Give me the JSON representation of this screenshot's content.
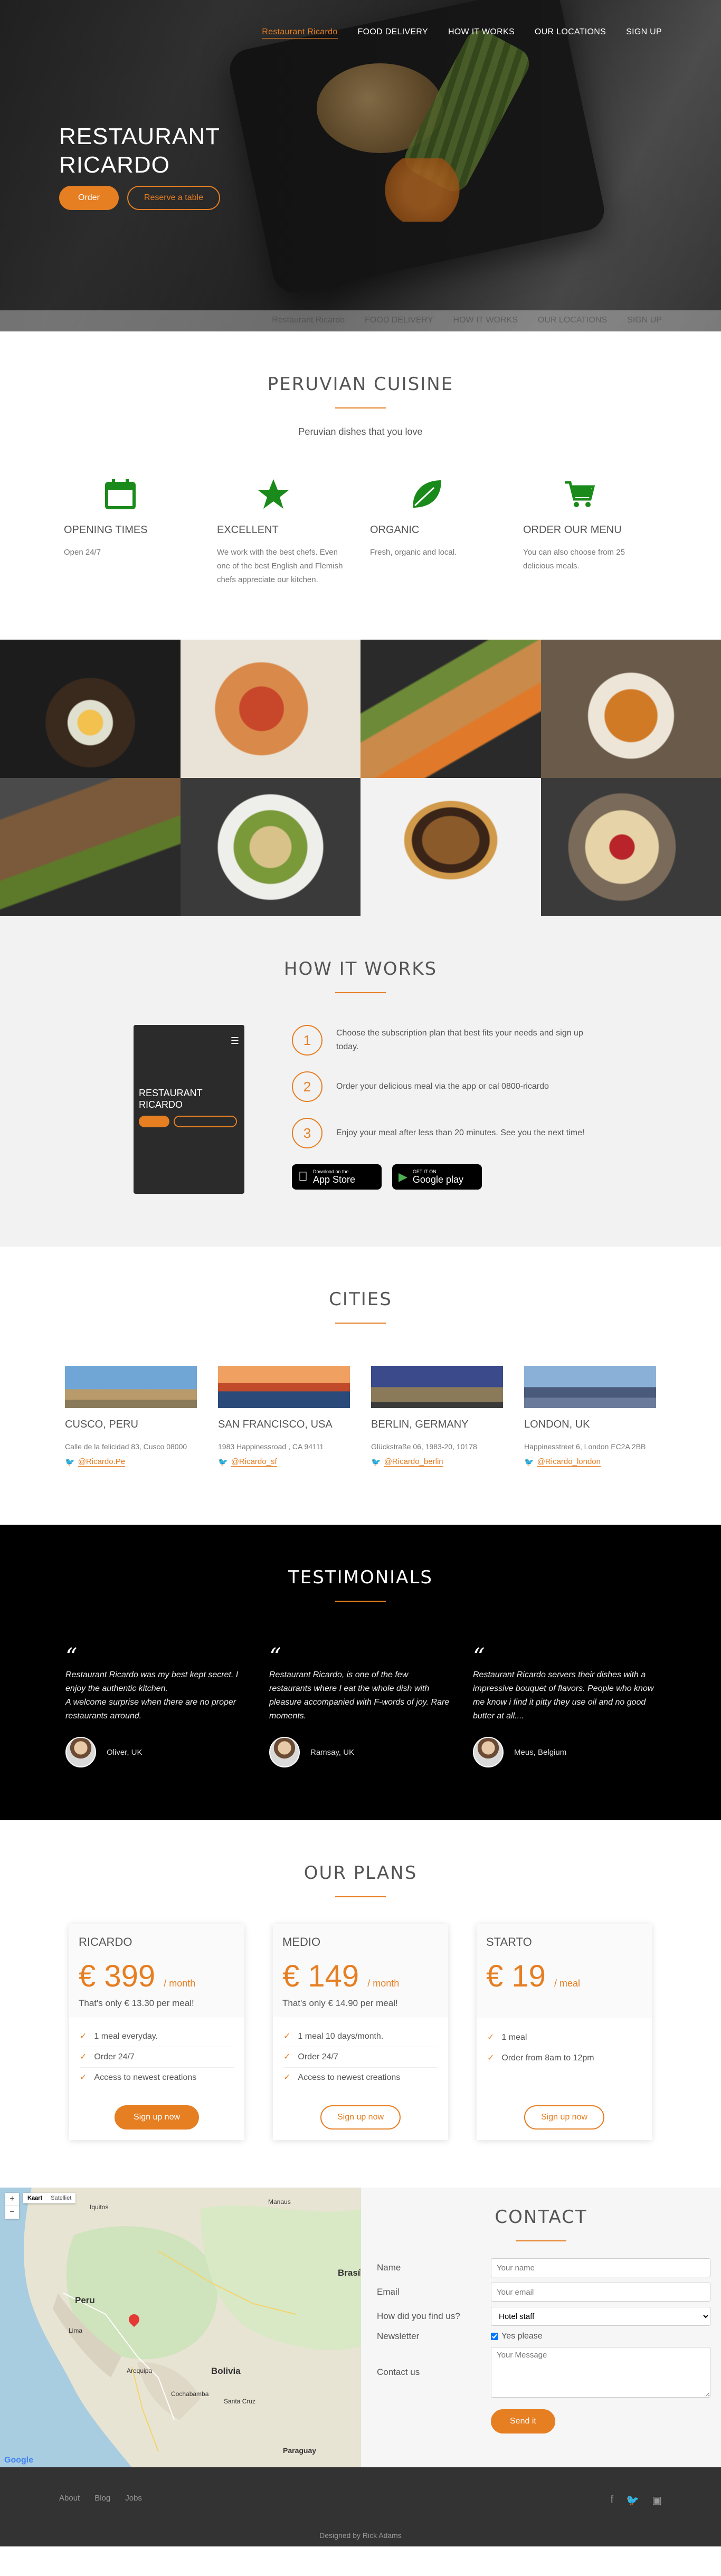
{
  "colors": {
    "accent": "#e67e22",
    "dark": "#000000",
    "light_bg": "#f2f2f2",
    "footer_bg": "#333333"
  },
  "nav": {
    "items": [
      "Restaurant Ricardo",
      "FOOD DELIVERY",
      "HOW IT WORKS",
      "OUR LOCATIONS",
      "SIGN UP"
    ]
  },
  "hero": {
    "title_line1": "RESTAURANT",
    "title_line2": "RICARDO",
    "order_label": "Order",
    "reserve_label": "Reserve a table"
  },
  "cuisine": {
    "title": "PERUVIAN CUISINE",
    "subtitle": "Peruvian dishes that you love",
    "features": [
      {
        "icon": "calendar-icon",
        "title": "OPENING TIMES",
        "text": "Open 24/7"
      },
      {
        "icon": "star-icon",
        "title": "EXCELLENT",
        "text": "We work with the best chefs. Even one of the best English and Flemish chefs appreciate our kitchen."
      },
      {
        "icon": "leaf-icon",
        "title": "ORGANIC",
        "text": "Fresh, organic and local."
      },
      {
        "icon": "cart-icon",
        "title": "ORDER OUR MENU",
        "text": "You can also choose from 25 delicious meals."
      }
    ]
  },
  "how": {
    "title": "HOW IT WORKS",
    "phone_title_line1": "RESTAURANT",
    "phone_title_line2": "RICARDO",
    "steps": [
      {
        "num": "1",
        "text": "Choose the subscription plan that best fits your needs and sign up today."
      },
      {
        "num": "2",
        "text": "Order your delicious meal via the app or cal 0800-ricardo"
      },
      {
        "num": "3",
        "text": "Enjoy your meal after less than 20 minutes. See you the next time!"
      }
    ],
    "appstore": {
      "small": "Download on the",
      "big": "App Store"
    },
    "googleplay": {
      "small": "GET IT ON",
      "big": "Google play"
    }
  },
  "cities": {
    "title": "CITIES",
    "items": [
      {
        "name": "CUSCO, PERU",
        "address": "Calle de la felicidad 83, Cusco 08000",
        "twitter": "@Ricardo.Pe"
      },
      {
        "name": "SAN FRANCISCO, USA",
        "address": "1983 Happinessroad , CA 94111",
        "twitter": "@Ricardo_sf"
      },
      {
        "name": "BERLIN, GERMANY",
        "address": "Glückstraße 06, 1983-20, 10178",
        "twitter": "@Ricardo_berlin"
      },
      {
        "name": "LONDON, UK",
        "address": "Happinesstreet 6, London EC2A 2BB",
        "twitter": "@Ricardo_london"
      }
    ]
  },
  "testimonials": {
    "title": "TESTIMONIALS",
    "items": [
      {
        "quote_line1": "Restaurant Ricardo was my best kept secret. I enjoy the authentic kitchen.",
        "quote_line2": "A welcome surprise when there are no proper restaurants arround.",
        "author": "Oliver, UK"
      },
      {
        "quote_line1": "Restaurant Ricardo, is one of the few restaurants where I eat the whole dish with pleasure accompanied with F-words of joy.",
        "quote_line2": "Rare moments.",
        "author": "Ramsay, UK"
      },
      {
        "quote_line1": "Restaurant Ricardo servers their dishes with a impressive bouquet of flavors. People who know me know i find it pitty they use oil and no good butter at all....",
        "quote_line2": "",
        "author": "Meus, Belgium"
      }
    ]
  },
  "plans": {
    "title": "OUR PLANS",
    "items": [
      {
        "name": "RICARDO",
        "price": "€ 399",
        "per": "/ month",
        "only": "That's only € 13.30 per meal!",
        "features": [
          "1 meal everyday.",
          "Order 24/7",
          "Access to newest creations"
        ],
        "button": "Sign up now",
        "filled": true
      },
      {
        "name": "MEDIO",
        "price": "€ 149",
        "per": "/ month",
        "only": "That's only € 14.90 per meal!",
        "features": [
          "1 meal 10 days/month.",
          "Order 24/7",
          "Access to newest creations"
        ],
        "button": "Sign up now",
        "filled": false
      },
      {
        "name": "STARTO",
        "price": "€ 19",
        "per": "/ meal",
        "only": "",
        "features": [
          "1 meal",
          "Order from 8am to 12pm"
        ],
        "button": "Sign up now",
        "filled": false
      }
    ]
  },
  "map": {
    "kaart": "Kaart",
    "satelliet": "Satelliet",
    "labels": [
      "Peru",
      "Lima",
      "Bolivia",
      "Brasília",
      "Manaus",
      "Arequipa",
      "Santa Cruz",
      "Paraguay",
      "Cochabamba",
      "Iquitos"
    ],
    "google": "Google"
  },
  "contact": {
    "title": "CONTACT",
    "name_label": "Name",
    "name_placeholder": "Your name",
    "email_label": "Email",
    "email_placeholder": "Your email",
    "find_label": "How did you find us?",
    "find_value": "Hotel staff",
    "newsletter_label": "Newsletter",
    "newsletter_text": "Yes please",
    "message_label": "Contact us",
    "message_placeholder": "Your Message",
    "send_label": "Send it"
  },
  "footer": {
    "links": [
      "About",
      "Blog",
      "Jobs"
    ],
    "credit": "Designed by Rick Adams"
  }
}
